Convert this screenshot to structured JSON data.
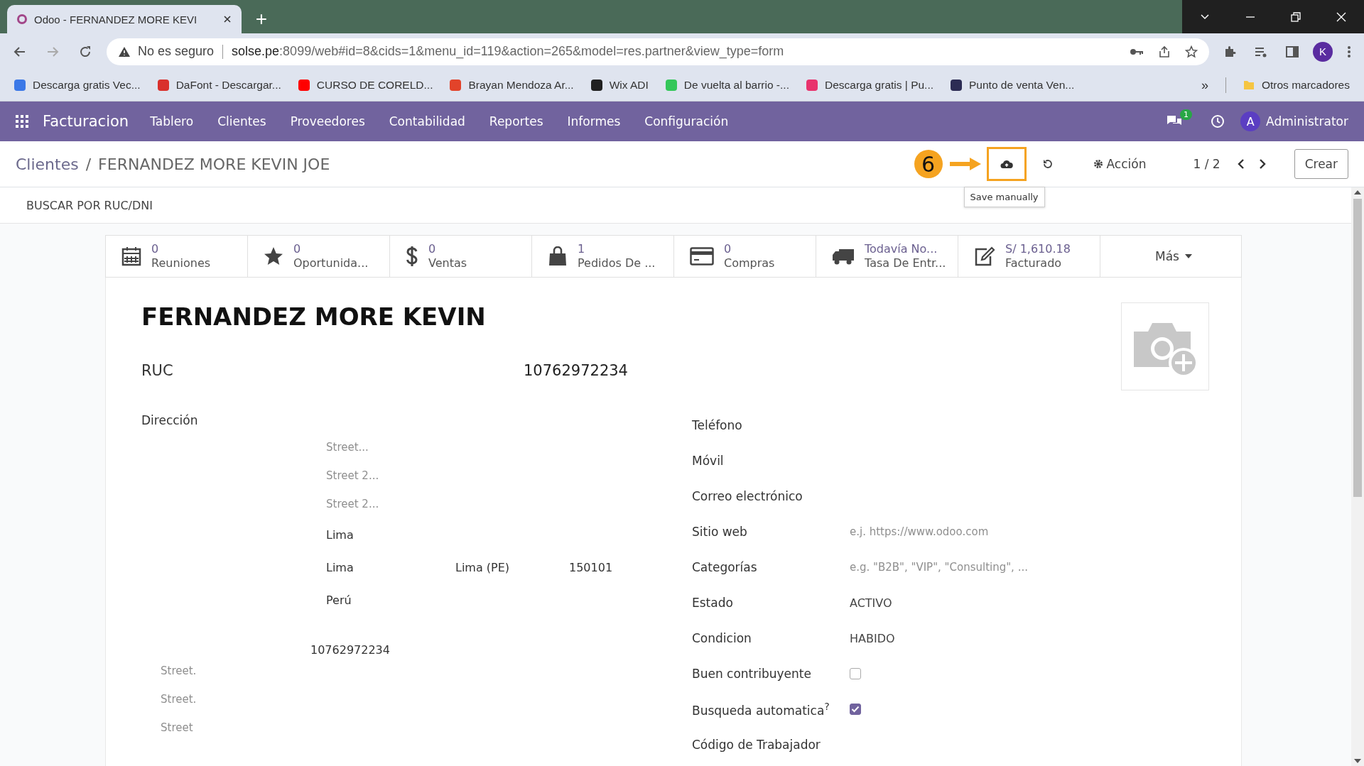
{
  "browser": {
    "tab_title": "Odoo - FERNANDEZ MORE KEVI",
    "new_tab": "+",
    "security": "No es seguro",
    "url_host": "solse.pe",
    "url_rest": ":8099/web#id=8&cids=1&menu_id=119&action=265&model=res.partner&view_type=form",
    "profile": "K",
    "bookmarks": [
      {
        "label": "Descarga gratis Vec...",
        "color": "#3b78e7"
      },
      {
        "label": "DaFont - Descargar...",
        "color": "#d9302c"
      },
      {
        "label": "CURSO DE CORELD...",
        "color": "#ff0000"
      },
      {
        "label": "Brayan Mendoza Ar...",
        "color": "#e2432a"
      },
      {
        "label": "Wix ADI",
        "color": "#202020"
      },
      {
        "label": "De vuelta al barrio -...",
        "color": "#34c759"
      },
      {
        "label": "Descarga gratis | Pu...",
        "color": "#e8336d"
      },
      {
        "label": "Punto de venta Ven...",
        "color": "#2c2c54"
      }
    ],
    "more": "»",
    "other_bookmarks": "Otros marcadores"
  },
  "navbar": {
    "app": "Facturacion",
    "menu": [
      "Tablero",
      "Clientes",
      "Proveedores",
      "Contabilidad",
      "Reportes",
      "Informes",
      "Configuración"
    ],
    "chat_badge": "1",
    "avatar": "A",
    "user": "Administrator"
  },
  "control_panel": {
    "breadcrumb": [
      "Clientes",
      "FERNANDEZ MORE KEVIN JOE"
    ],
    "breadcrumb_separator": "/",
    "step": "6",
    "tooltip": "Save manually",
    "action": "Acción",
    "pager": "1 / 2",
    "create": "Crear"
  },
  "search_label": "BUSCAR POR RUC/DNI",
  "stats": [
    {
      "kind": "calendar",
      "value": "0",
      "label": "Reuniones"
    },
    {
      "kind": "star",
      "value": "0",
      "label": "Oportunida..."
    },
    {
      "kind": "dollar",
      "value": "0",
      "label": "Ventas"
    },
    {
      "kind": "bag",
      "value": "1",
      "label": "Pedidos De ..."
    },
    {
      "kind": "card",
      "value": "0",
      "label": "Compras"
    },
    {
      "kind": "truck",
      "value": "Todavía No...",
      "label": "Tasa De Entr..."
    },
    {
      "kind": "edit",
      "value": "S/ 1,610.18",
      "label": "Facturado"
    }
  ],
  "stats_more": "Más",
  "form": {
    "name": "FERNANDEZ MORE KEVIN",
    "doc_type": "RUC",
    "doc_number": "10762972234",
    "address_label": "Dirección",
    "street": {
      "placeholder": "Street..."
    },
    "street2": {
      "placeholder": "Street 2..."
    },
    "street3": {
      "placeholder": "Street 2..."
    },
    "district": "Lima",
    "city": "Lima",
    "state": "Lima (PE)",
    "zip": "150101",
    "country": "Perú",
    "vat": "10762972234",
    "extra_streets": [
      {
        "placeholder": "Street."
      },
      {
        "placeholder": "Street."
      },
      {
        "placeholder": "Street"
      }
    ],
    "right": [
      {
        "kind": "text",
        "label": "Teléfono"
      },
      {
        "kind": "text",
        "label": "Móvil"
      },
      {
        "kind": "text",
        "label": "Correo electrónico"
      },
      {
        "kind": "text",
        "label": "Sitio web",
        "placeholder": "e.j. https://www.odoo.com"
      },
      {
        "kind": "text",
        "label": "Categorías",
        "placeholder": "e.g. \"B2B\", \"VIP\", \"Consulting\", ..."
      },
      {
        "kind": "text",
        "label": "Estado",
        "value": "ACTIVO"
      },
      {
        "kind": "text",
        "label": "Condicion",
        "value": "HABIDO"
      },
      {
        "kind": "checkbox",
        "label": "Buen contribuyente",
        "checked": false
      },
      {
        "kind": "checkbox",
        "label": "Busqueda automatica$^{?}$",
        "checked": true
      },
      {
        "kind": "text",
        "label": "Código de Trabajador"
      }
    ]
  }
}
